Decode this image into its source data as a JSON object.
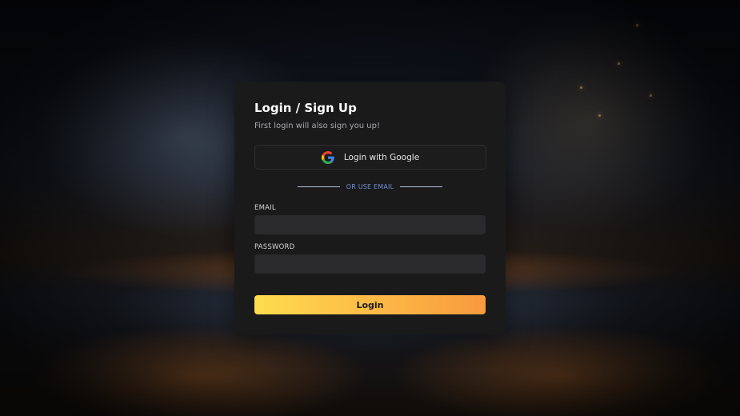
{
  "auth": {
    "title": "Login / Sign Up",
    "subtitle": "First login will also sign you up!",
    "google_button_label": "Login with Google",
    "google_icon": "google-g-logo",
    "divider_text": "OR USE EMAIL",
    "email_label": "EMAIL",
    "email_value": "",
    "password_label": "PASSWORD",
    "password_value": "",
    "submit_label": "Login"
  },
  "colors": {
    "card_background": "#1a1a1b",
    "input_background": "#2a2a2c",
    "divider_text": "#6f8fd6",
    "button_gradient_start": "#fddc4e",
    "button_gradient_end": "#f89a3e"
  }
}
